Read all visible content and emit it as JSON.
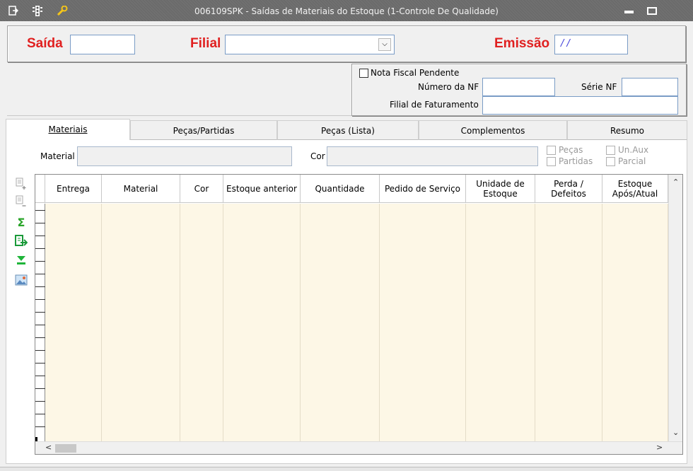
{
  "window": {
    "title": "006109SPK - Saídas de Materiais do Estoque (1-Controle De Qualidade)"
  },
  "header": {
    "saida_label": "Saída",
    "saida_value": "",
    "filial_label": "Filial",
    "filial_value": "",
    "emissao_label": "Emissão",
    "emissao_value": " / /"
  },
  "nf": {
    "pendente_label": "Nota Fiscal Pendente",
    "numero_label": "Número da NF",
    "serie_label": "Série NF",
    "filial_faturamento_label": "Filial de Faturamento"
  },
  "tabs": [
    {
      "label": "Materiais"
    },
    {
      "label": "Peças/Partidas"
    },
    {
      "label": "Peças (Lista)"
    },
    {
      "label": "Complementos"
    },
    {
      "label": "Resumo"
    }
  ],
  "filters": {
    "material_label": "Material",
    "cor_label": "Cor",
    "pecas_label": "Peças",
    "partidas_label": "Partidas",
    "unaux_label": "Un.Aux",
    "parcial_label": "Parcial"
  },
  "grid": {
    "columns": [
      "Entrega",
      "Material",
      "Cor",
      "Estoque anterior",
      "Quantidade",
      "Pedido de Serviço",
      "Unidade de Estoque",
      "Perda / Defeitos",
      "Estoque Após/Atual"
    ]
  },
  "icons": {
    "titlebar": [
      "export-icon",
      "traffic-light-icon",
      "wrench-icon"
    ],
    "side": [
      "add-row-icon",
      "remove-row-icon",
      "sum-icon",
      "export-data-icon",
      "download-icon",
      "image-icon"
    ]
  }
}
